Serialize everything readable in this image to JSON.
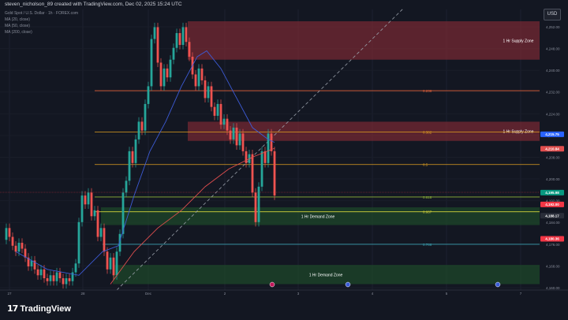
{
  "header": {
    "title": "steven_nicholson_89 created with TradingView.com, Dec 02, 2025 15:24 UTC",
    "symbol": "Gold Spot / U.S. Dollar · 1h · FOREX.com",
    "indicators": [
      "MA (20, close)",
      "MA (50, close)",
      "MA (200, close)"
    ],
    "currency": "USD"
  },
  "brand": {
    "logo_mark": "17",
    "name": "TradingView"
  },
  "colors": {
    "background": "#131722",
    "bull": "#26a69a",
    "bear": "#ef5350",
    "supply": "#7a2a33",
    "demand": "#1e4a2a",
    "ma20": "#3d5bd6",
    "ma50": "#e04e4e",
    "ma200": "#2f6fd0",
    "trend": "#9aa0aa"
  },
  "chart_data": {
    "type": "candlestick",
    "y_axis_ticks": [
      "4,252.00",
      "4,248.00",
      "4,240.00",
      "4,232.00",
      "4,224.00",
      "4,216.00",
      "4,208.00",
      "4,200.00",
      "4,192.00",
      "4,184.00",
      "4,176.00",
      "4,168.00",
      "4,160.00"
    ],
    "price_labels": [
      {
        "value": 4215.75,
        "text": "4,215.75",
        "color": "#2962ff"
      },
      {
        "value": 4210.84,
        "text": "4,210.84",
        "color": "#e04e4e"
      },
      {
        "value": 4195.98,
        "text": "4,195.98",
        "color": "#089981"
      },
      {
        "value": 4192.0,
        "text": "4,192.00",
        "color": "#f23645"
      },
      {
        "value": 4188.17,
        "text": "4,188.17",
        "color": "#2a2e39"
      },
      {
        "value": 4180.36,
        "text": "4,180.36",
        "color": "#f23645"
      }
    ],
    "fib_levels": [
      {
        "label": "0.236",
        "value": 4230.5,
        "color": "#e0603a"
      },
      {
        "label": "0.382",
        "value": 4216.5,
        "color": "#e0a020"
      },
      {
        "label": "0.5",
        "value": 4205.5,
        "color": "#e0a020"
      },
      {
        "label": "0.618",
        "value": 4194.5,
        "color": "#8fb33a"
      },
      {
        "label": "0.667",
        "value": 4189.5,
        "color": "#d4d43a"
      },
      {
        "label": "0.786",
        "value": 4178.5,
        "color": "#3aa0b0"
      }
    ],
    "zones": [
      {
        "label": "1 Hr Supply Zone",
        "type": "supply",
        "from": 4241.0,
        "to": 4254.0
      },
      {
        "label": "1 Hr Supply Zone",
        "type": "supply",
        "from": 4213.5,
        "to": 4220.0
      },
      {
        "label": "1 Hr Demand Zone",
        "type": "demand",
        "from": 4185.0,
        "to": 4191.0
      },
      {
        "label": "1 Hr Demand Zone",
        "type": "demand",
        "from": 4165.0,
        "to": 4171.5
      }
    ],
    "x_axis_ticks": [
      "27",
      "28",
      "Dec",
      "2",
      "3",
      "4",
      "5",
      "7"
    ],
    "ylim": [
      4163,
      4258
    ]
  }
}
